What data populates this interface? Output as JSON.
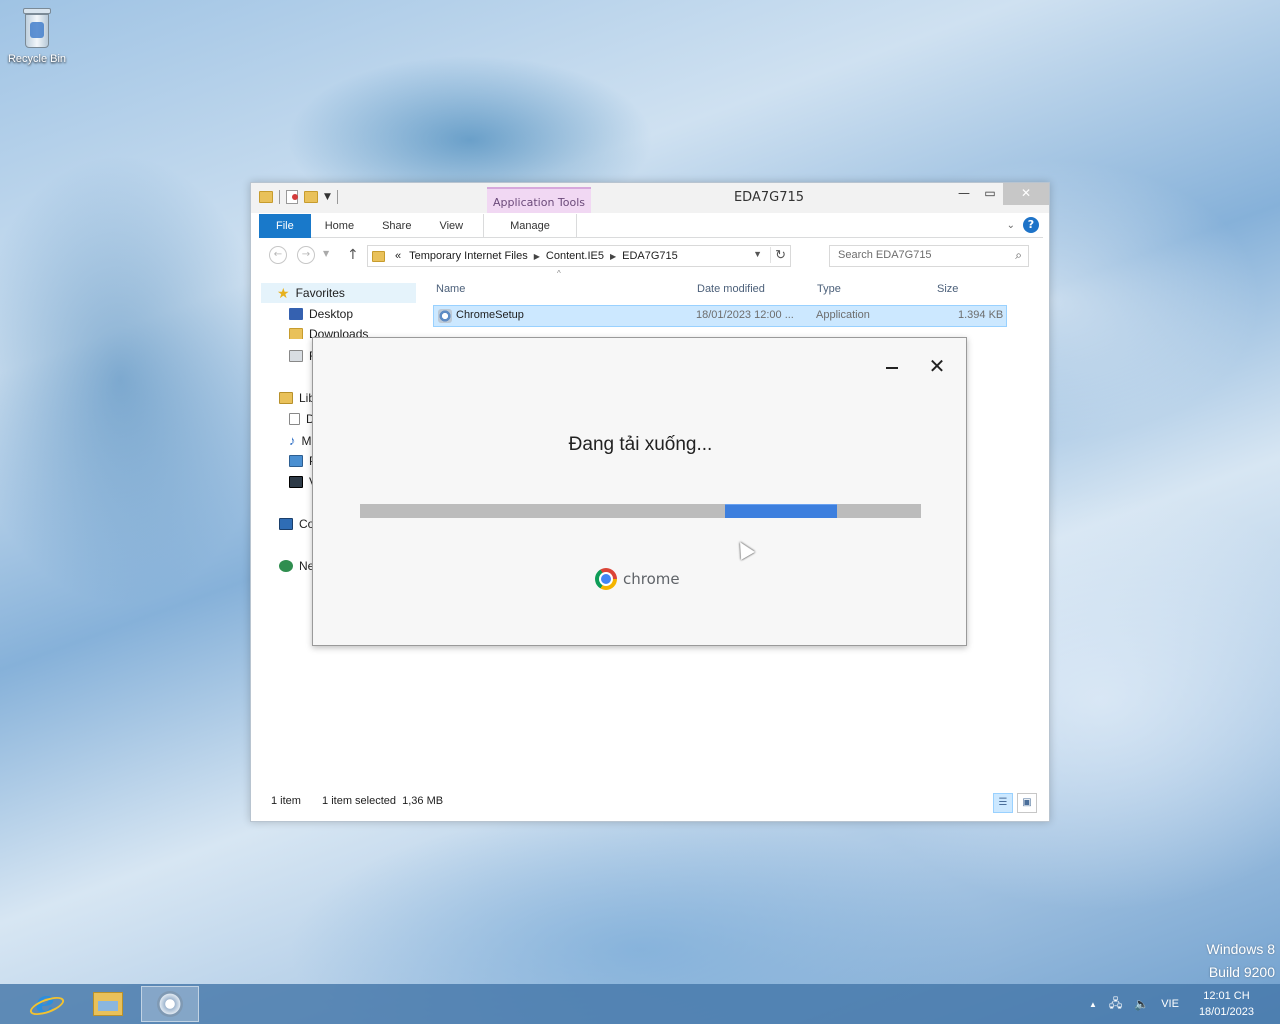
{
  "desktop": {
    "recycle_bin_label": "Recycle Bin"
  },
  "explorer": {
    "title": "EDA7G715",
    "contextual_tab": "Application Tools",
    "ribbon_tabs": [
      "File",
      "Home",
      "Share",
      "View",
      "Manage"
    ],
    "address": {
      "overflow": "«",
      "crumbs": [
        "Temporary Internet Files",
        "Content.IE5",
        "EDA7G715"
      ]
    },
    "search_placeholder": "Search EDA7G715",
    "nav_pane": {
      "favorites": "Favorites",
      "desktop": "Desktop",
      "downloads": "Downloads",
      "recent": "R",
      "libraries": "Lib",
      "documents": "D",
      "music": "M",
      "pictures": "P",
      "videos": "V",
      "computer": "Co",
      "network": "Ne"
    },
    "columns": [
      "Name",
      "Date modified",
      "Type",
      "Size"
    ],
    "files": [
      {
        "name": "ChromeSetup",
        "date": "18/01/2023 12:00 ...",
        "type": "Application",
        "size": "1.394 KB"
      }
    ],
    "status": {
      "items": "1 item",
      "selected": "1 item selected  1,36 MB"
    }
  },
  "installer": {
    "status_text": "Đang tải xuống...",
    "brand": "chrome",
    "progress_indeterminate_start": 0.65,
    "progress_indeterminate_width": 0.2
  },
  "watermark": {
    "line1": "Windows 8",
    "line2": "Build 9200"
  },
  "taskbar": {
    "language": "VIE",
    "time": "12:01 CH",
    "date": "18/01/2023"
  },
  "colors": {
    "file_tab": "#1979ca",
    "app_tools_tab": "#f1d8f3",
    "progress_fill": "#3d7fde",
    "selection": "#cce8ff"
  }
}
